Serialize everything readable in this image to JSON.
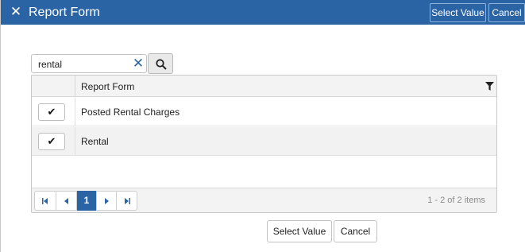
{
  "titlebar": {
    "title": "Report Form",
    "close_icon": "close-icon",
    "select_value_label": "Select Value",
    "cancel_label": "Cancel",
    "color": "#2b64a5"
  },
  "search": {
    "value": "rental",
    "clear_icon": "clear-icon",
    "search_icon": "search-icon"
  },
  "grid": {
    "header": {
      "column": "Report Form",
      "filter_icon": "filter-icon"
    },
    "rows": [
      {
        "label": "Posted Rental Charges",
        "select_icon": "checkmark-icon"
      },
      {
        "label": "Rental",
        "select_icon": "checkmark-icon"
      }
    ],
    "pager": {
      "current_page": "1",
      "info": "1 - 2 of 2 items"
    }
  },
  "footer": {
    "select_value_label": "Select Value",
    "cancel_label": "Cancel"
  }
}
